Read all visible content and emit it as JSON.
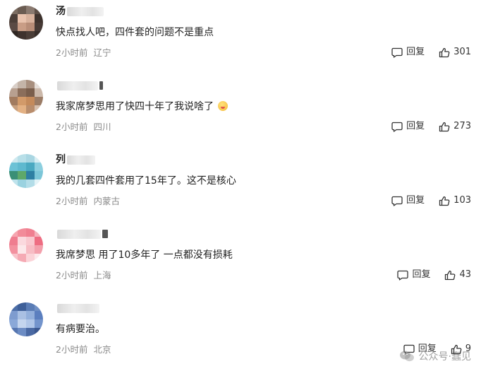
{
  "comments": [
    {
      "user_initial": "汤",
      "text": "快点找人吧，四件套的问题不是重点",
      "time": "2小时前",
      "location": "辽宁",
      "reply_label": "回复",
      "likes": "301",
      "emoji": false
    },
    {
      "user_initial": "",
      "text": "我家席梦思用了快四十年了我说啥了",
      "time": "2小时前",
      "location": "四川",
      "reply_label": "回复",
      "likes": "273",
      "emoji": true
    },
    {
      "user_initial": "列",
      "text": "我的几套四件套用了15年了。这不是核心",
      "time": "2小时前",
      "location": "内蒙古",
      "reply_label": "回复",
      "likes": "103",
      "emoji": false
    },
    {
      "user_initial": "",
      "text": "我席梦思 用了10多年了 一点都没有损耗",
      "time": "2小时前",
      "location": "上海",
      "reply_label": "回复",
      "likes": "43",
      "emoji": false
    },
    {
      "user_initial": "",
      "text": "有病要治。",
      "time": "2小时前",
      "location": "北京",
      "reply_label": "回复",
      "likes": "9",
      "emoji": false
    }
  ],
  "watermark": {
    "text": "公众号·蠢见"
  },
  "icons": {
    "reply": "comment-bubble-icon",
    "like": "thumbs-up-icon",
    "watermark": "wechat-icon"
  }
}
